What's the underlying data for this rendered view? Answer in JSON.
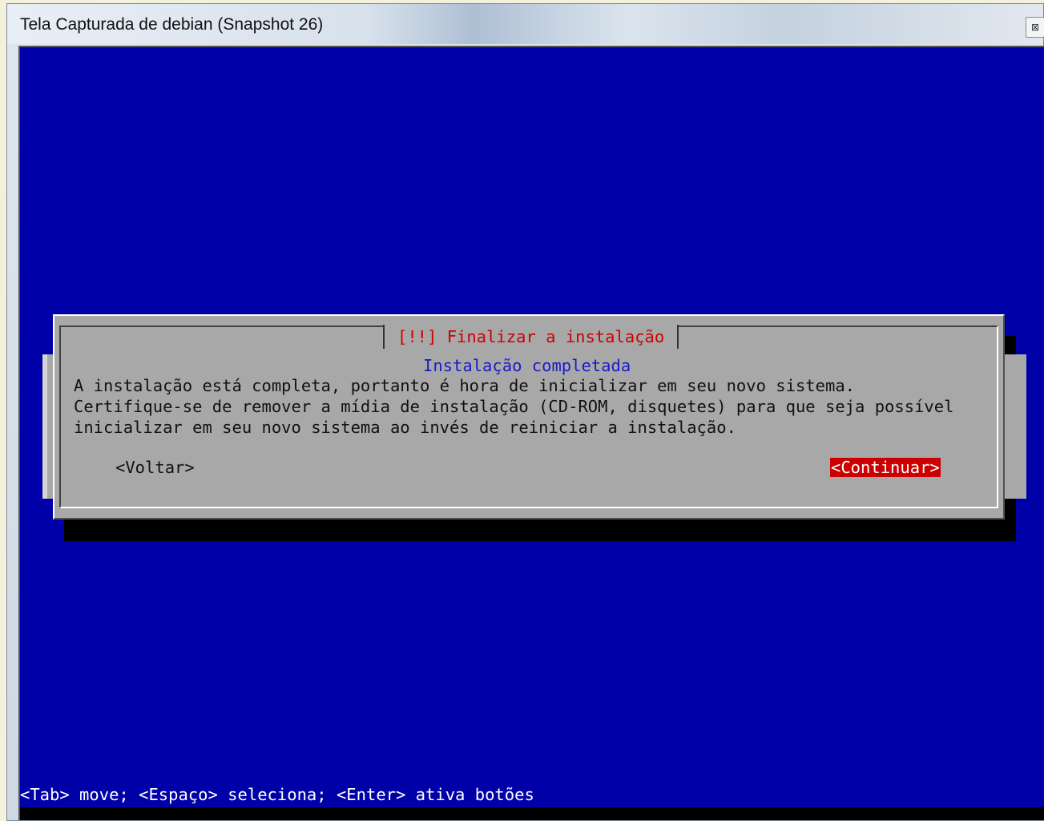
{
  "window": {
    "title": "Tela Capturada de debian (Snapshot 26)",
    "close_icon": "close-icon"
  },
  "dialog": {
    "title": "[!!] Finalizar a instalação",
    "subtitle": "Instalação completada",
    "lines": [
      "A instalação está completa, portanto é hora de inicializar em seu novo sistema.",
      "Certifique-se de remover a mídia de instalação (CD-ROM, disquetes) para que seja possível",
      "inicializar em seu novo sistema ao invés de reiniciar a instalação."
    ],
    "back_label": "<Voltar>",
    "continue_label": "<Continuar>"
  },
  "statusbar": {
    "text": "<Tab> move; <Espaço> seleciona; <Enter> ativa botões"
  },
  "colors": {
    "screen_bg": "#0000a8",
    "dialog_bg": "#a8a8a8",
    "title_red": "#cc0000",
    "subtitle_blue": "#1a1ac8",
    "selected_button_bg": "#cc0000"
  }
}
